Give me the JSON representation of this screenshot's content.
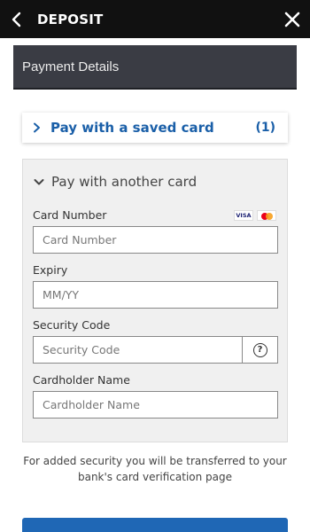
{
  "header": {
    "title": "DEPOSIT"
  },
  "section": {
    "title": "Payment Details"
  },
  "saved_card": {
    "label": "Pay with a saved card",
    "count": "(1)"
  },
  "other_card": {
    "label": "Pay with another card",
    "card_brands": [
      "VISA",
      "mastercard"
    ],
    "fields": {
      "card_number": {
        "label": "Card Number",
        "placeholder": "Card Number",
        "value": ""
      },
      "expiry": {
        "label": "Expiry",
        "placeholder": "MM/YY",
        "value": ""
      },
      "security_code": {
        "label": "Security Code",
        "placeholder": "Security Code",
        "value": "",
        "help_icon": "question-circle"
      },
      "cardholder_name": {
        "label": "Cardholder Name",
        "placeholder": "Cardholder Name",
        "value": ""
      }
    }
  },
  "security_note": "For added security you will be transferred to your bank's card verification page",
  "colors": {
    "topbar": "#111111",
    "section_header": "#3a3c44",
    "accent_blue": "#1a5fa8",
    "button_blue": "#1f67b5",
    "panel_bg": "#f0f0f0"
  },
  "icons": {
    "back": "chevron-left-icon",
    "close": "close-icon",
    "expand": "chevron-right-icon",
    "collapse": "chevron-down-icon"
  }
}
